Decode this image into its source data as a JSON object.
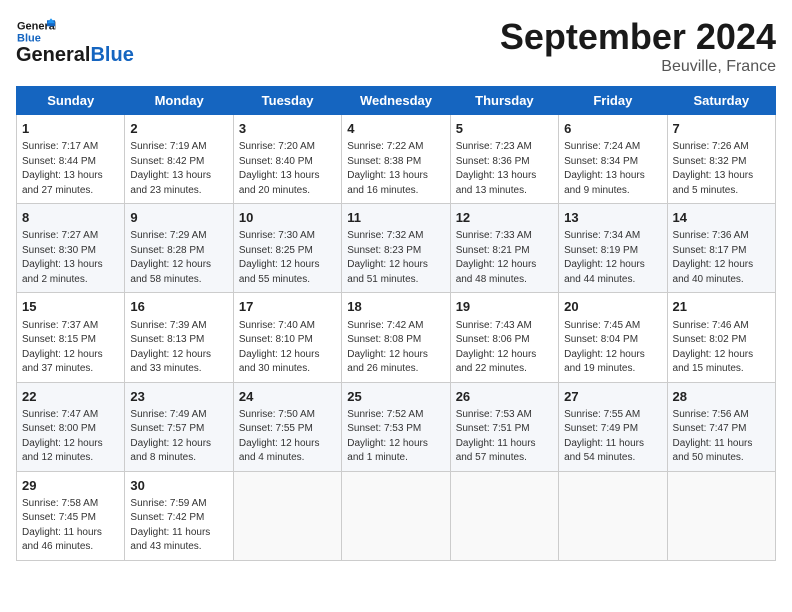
{
  "header": {
    "logo_line1": "General",
    "logo_line2": "Blue",
    "month": "September 2024",
    "location": "Beuville, France"
  },
  "weekdays": [
    "Sunday",
    "Monday",
    "Tuesday",
    "Wednesday",
    "Thursday",
    "Friday",
    "Saturday"
  ],
  "weeks": [
    [
      {
        "day": "1",
        "lines": [
          "Sunrise: 7:17 AM",
          "Sunset: 8:44 PM",
          "Daylight: 13 hours",
          "and 27 minutes."
        ]
      },
      {
        "day": "2",
        "lines": [
          "Sunrise: 7:19 AM",
          "Sunset: 8:42 PM",
          "Daylight: 13 hours",
          "and 23 minutes."
        ]
      },
      {
        "day": "3",
        "lines": [
          "Sunrise: 7:20 AM",
          "Sunset: 8:40 PM",
          "Daylight: 13 hours",
          "and 20 minutes."
        ]
      },
      {
        "day": "4",
        "lines": [
          "Sunrise: 7:22 AM",
          "Sunset: 8:38 PM",
          "Daylight: 13 hours",
          "and 16 minutes."
        ]
      },
      {
        "day": "5",
        "lines": [
          "Sunrise: 7:23 AM",
          "Sunset: 8:36 PM",
          "Daylight: 13 hours",
          "and 13 minutes."
        ]
      },
      {
        "day": "6",
        "lines": [
          "Sunrise: 7:24 AM",
          "Sunset: 8:34 PM",
          "Daylight: 13 hours",
          "and 9 minutes."
        ]
      },
      {
        "day": "7",
        "lines": [
          "Sunrise: 7:26 AM",
          "Sunset: 8:32 PM",
          "Daylight: 13 hours",
          "and 5 minutes."
        ]
      }
    ],
    [
      {
        "day": "8",
        "lines": [
          "Sunrise: 7:27 AM",
          "Sunset: 8:30 PM",
          "Daylight: 13 hours",
          "and 2 minutes."
        ]
      },
      {
        "day": "9",
        "lines": [
          "Sunrise: 7:29 AM",
          "Sunset: 8:28 PM",
          "Daylight: 12 hours",
          "and 58 minutes."
        ]
      },
      {
        "day": "10",
        "lines": [
          "Sunrise: 7:30 AM",
          "Sunset: 8:25 PM",
          "Daylight: 12 hours",
          "and 55 minutes."
        ]
      },
      {
        "day": "11",
        "lines": [
          "Sunrise: 7:32 AM",
          "Sunset: 8:23 PM",
          "Daylight: 12 hours",
          "and 51 minutes."
        ]
      },
      {
        "day": "12",
        "lines": [
          "Sunrise: 7:33 AM",
          "Sunset: 8:21 PM",
          "Daylight: 12 hours",
          "and 48 minutes."
        ]
      },
      {
        "day": "13",
        "lines": [
          "Sunrise: 7:34 AM",
          "Sunset: 8:19 PM",
          "Daylight: 12 hours",
          "and 44 minutes."
        ]
      },
      {
        "day": "14",
        "lines": [
          "Sunrise: 7:36 AM",
          "Sunset: 8:17 PM",
          "Daylight: 12 hours",
          "and 40 minutes."
        ]
      }
    ],
    [
      {
        "day": "15",
        "lines": [
          "Sunrise: 7:37 AM",
          "Sunset: 8:15 PM",
          "Daylight: 12 hours",
          "and 37 minutes."
        ]
      },
      {
        "day": "16",
        "lines": [
          "Sunrise: 7:39 AM",
          "Sunset: 8:13 PM",
          "Daylight: 12 hours",
          "and 33 minutes."
        ]
      },
      {
        "day": "17",
        "lines": [
          "Sunrise: 7:40 AM",
          "Sunset: 8:10 PM",
          "Daylight: 12 hours",
          "and 30 minutes."
        ]
      },
      {
        "day": "18",
        "lines": [
          "Sunrise: 7:42 AM",
          "Sunset: 8:08 PM",
          "Daylight: 12 hours",
          "and 26 minutes."
        ]
      },
      {
        "day": "19",
        "lines": [
          "Sunrise: 7:43 AM",
          "Sunset: 8:06 PM",
          "Daylight: 12 hours",
          "and 22 minutes."
        ]
      },
      {
        "day": "20",
        "lines": [
          "Sunrise: 7:45 AM",
          "Sunset: 8:04 PM",
          "Daylight: 12 hours",
          "and 19 minutes."
        ]
      },
      {
        "day": "21",
        "lines": [
          "Sunrise: 7:46 AM",
          "Sunset: 8:02 PM",
          "Daylight: 12 hours",
          "and 15 minutes."
        ]
      }
    ],
    [
      {
        "day": "22",
        "lines": [
          "Sunrise: 7:47 AM",
          "Sunset: 8:00 PM",
          "Daylight: 12 hours",
          "and 12 minutes."
        ]
      },
      {
        "day": "23",
        "lines": [
          "Sunrise: 7:49 AM",
          "Sunset: 7:57 PM",
          "Daylight: 12 hours",
          "and 8 minutes."
        ]
      },
      {
        "day": "24",
        "lines": [
          "Sunrise: 7:50 AM",
          "Sunset: 7:55 PM",
          "Daylight: 12 hours",
          "and 4 minutes."
        ]
      },
      {
        "day": "25",
        "lines": [
          "Sunrise: 7:52 AM",
          "Sunset: 7:53 PM",
          "Daylight: 12 hours",
          "and 1 minute."
        ]
      },
      {
        "day": "26",
        "lines": [
          "Sunrise: 7:53 AM",
          "Sunset: 7:51 PM",
          "Daylight: 11 hours",
          "and 57 minutes."
        ]
      },
      {
        "day": "27",
        "lines": [
          "Sunrise: 7:55 AM",
          "Sunset: 7:49 PM",
          "Daylight: 11 hours",
          "and 54 minutes."
        ]
      },
      {
        "day": "28",
        "lines": [
          "Sunrise: 7:56 AM",
          "Sunset: 7:47 PM",
          "Daylight: 11 hours",
          "and 50 minutes."
        ]
      }
    ],
    [
      {
        "day": "29",
        "lines": [
          "Sunrise: 7:58 AM",
          "Sunset: 7:45 PM",
          "Daylight: 11 hours",
          "and 46 minutes."
        ]
      },
      {
        "day": "30",
        "lines": [
          "Sunrise: 7:59 AM",
          "Sunset: 7:42 PM",
          "Daylight: 11 hours",
          "and 43 minutes."
        ]
      },
      {
        "day": "",
        "lines": []
      },
      {
        "day": "",
        "lines": []
      },
      {
        "day": "",
        "lines": []
      },
      {
        "day": "",
        "lines": []
      },
      {
        "day": "",
        "lines": []
      }
    ]
  ]
}
